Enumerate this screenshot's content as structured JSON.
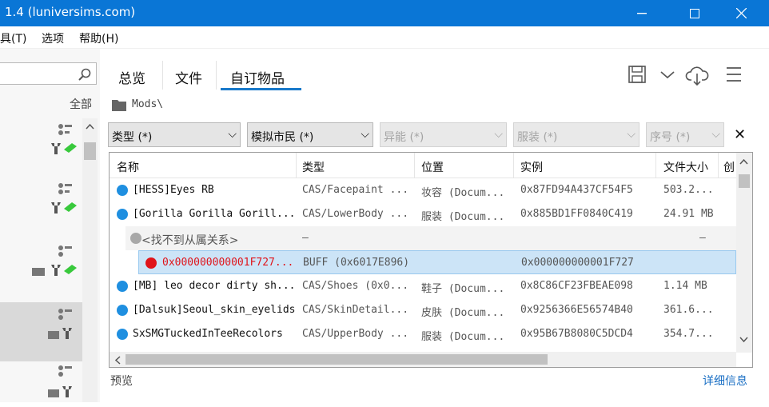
{
  "title": "1.4  (luniversims.com)",
  "menu": {
    "tools": "具(T)",
    "options": "选项",
    "help": "帮助(H)"
  },
  "sidebar": {
    "all": "全部"
  },
  "tabs": [
    "总览",
    "文件",
    "自订物品"
  ],
  "path": "Mods\\",
  "filters": [
    {
      "label": "类型 (*)",
      "enabled": true
    },
    {
      "label": "模拟市民 (*)",
      "enabled": true
    },
    {
      "label": "异能 (*)",
      "enabled": false
    },
    {
      "label": "服装 (*)",
      "enabled": false
    },
    {
      "label": "序号 (*)",
      "enabled": false
    }
  ],
  "close": "✕",
  "columns": [
    "名称",
    "类型",
    "位置",
    "实例",
    "文件大小",
    "创"
  ],
  "rows": [
    {
      "name": "[HESS]Eyes RB",
      "type": "CAS/Facepaint ...",
      "loc": "妆容 (Docum...",
      "inst": "0x87FD94A437CF54F5",
      "size": "503.2...",
      "color": "#1f8fe0"
    },
    {
      "name": "[Gorilla Gorilla Gorill...",
      "type": "CAS/LowerBody ...",
      "loc": "服装 (Docum...",
      "inst": "0x885BD1FF0840C419",
      "size": "24.91 MB",
      "color": "#1f8fe0"
    },
    {
      "name": "<找不到从属关系>",
      "type": "—",
      "loc": "",
      "inst": "",
      "size": "—",
      "color": "#a8a8a8"
    },
    {
      "name": "0x000000000001F727...",
      "type": "BUFF (0x6017E896)",
      "loc": "",
      "inst": "0x000000000001F727",
      "size": "",
      "color": "#e0141a"
    },
    {
      "name": "[MB] leo decor dirty sh...",
      "type": "CAS/Shoes (0x0...",
      "loc": "鞋子 (Docum...",
      "inst": "0x8C86CF23FBEAE098",
      "size": "1.14 MB",
      "color": "#1f8fe0"
    },
    {
      "name": "[Dalsuk]Seoul_skin_eyelids",
      "type": "CAS/SkinDetail...",
      "loc": "皮肤 (Docum...",
      "inst": "0x9256366E56574B40",
      "size": "361.6...",
      "color": "#1f8fe0"
    },
    {
      "name": "SxSMGTuckedInTeeRecolors",
      "type": "CAS/UpperBody ...",
      "loc": "服装 (Docum...",
      "inst": "0x95B67B8080C5DCD4",
      "size": "354.7...",
      "color": "#1f8fe0"
    }
  ],
  "footer": {
    "preview": "预览",
    "details": "详细信息"
  },
  "colors": {
    "titlebar": "#0a76d6",
    "accent": "#1979ca",
    "selected": "#cce4f7"
  }
}
